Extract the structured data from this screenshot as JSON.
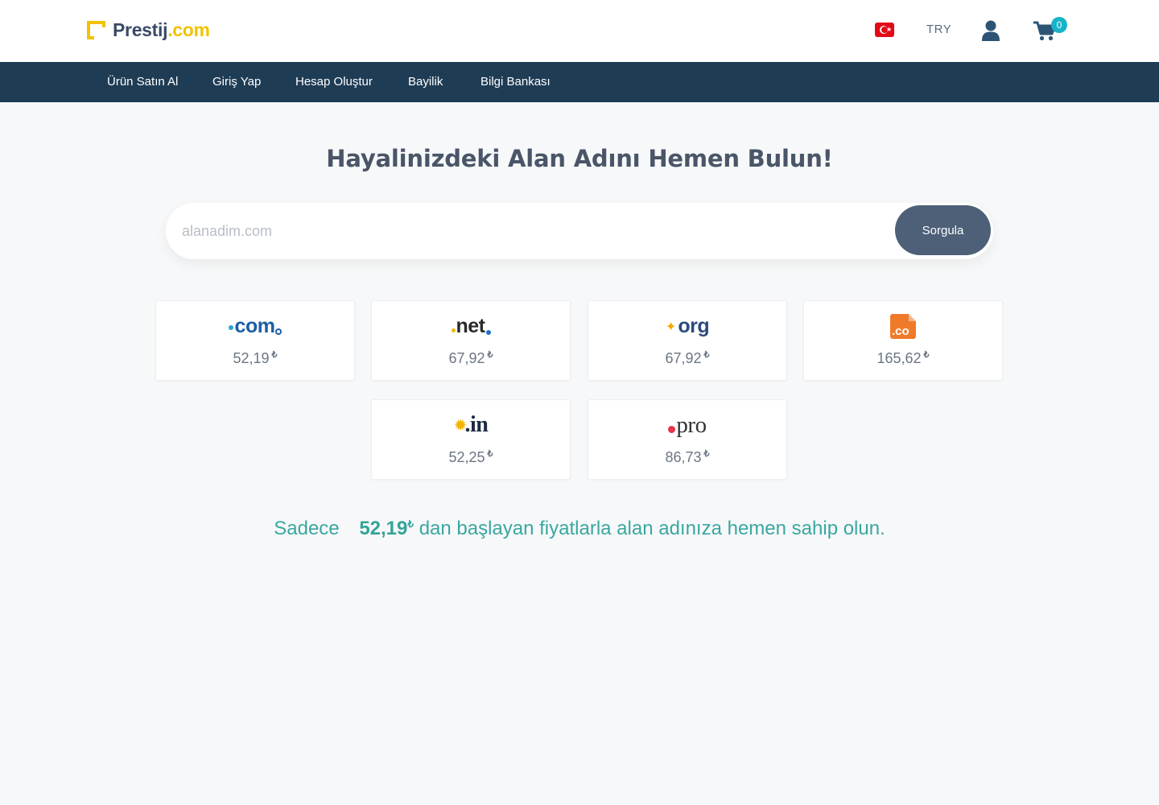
{
  "header": {
    "logo": {
      "part1": "Prestij",
      "part2": ".com"
    },
    "currency": "TRY",
    "cart_count": "0",
    "flag": "turkey-flag-icon"
  },
  "nav": {
    "items": [
      {
        "label": "Ürün Satın Al"
      },
      {
        "label": "Giriş Yap"
      },
      {
        "label": "Hesap Oluştur"
      },
      {
        "label": "Bayilik"
      },
      {
        "label": "Bilgi Bankası"
      }
    ]
  },
  "hero": {
    "title": "Hayalinizdeki Alan Adını Hemen Bulun!",
    "search_placeholder": "alanadim.com",
    "search_button": "Sorgula"
  },
  "tlds": [
    {
      "name": ".com",
      "price": "52,19",
      "currency_symbol": "₺"
    },
    {
      "name": ".net",
      "price": "67,92",
      "currency_symbol": "₺"
    },
    {
      "name": ".org",
      "price": "67,92",
      "currency_symbol": "₺"
    },
    {
      "name": ".co",
      "price": "165,62",
      "currency_symbol": "₺"
    },
    {
      "name": ".in",
      "price": "52,25",
      "currency_symbol": "₺"
    },
    {
      "name": ".pro",
      "price": "86,73",
      "currency_symbol": "₺"
    }
  ],
  "promo": {
    "prefix": "Sadece",
    "amount": "52,19",
    "currency_symbol": "₺",
    "suffix": "dan başlayan fiyatlarla alan adınıza hemen sahip olun."
  },
  "colors": {
    "nav_bg": "#1f3c55",
    "accent_yellow": "#f2c200",
    "button_bg": "#4d6078",
    "promo_teal": "#3aa7a0",
    "badge": "#17b3c8"
  }
}
